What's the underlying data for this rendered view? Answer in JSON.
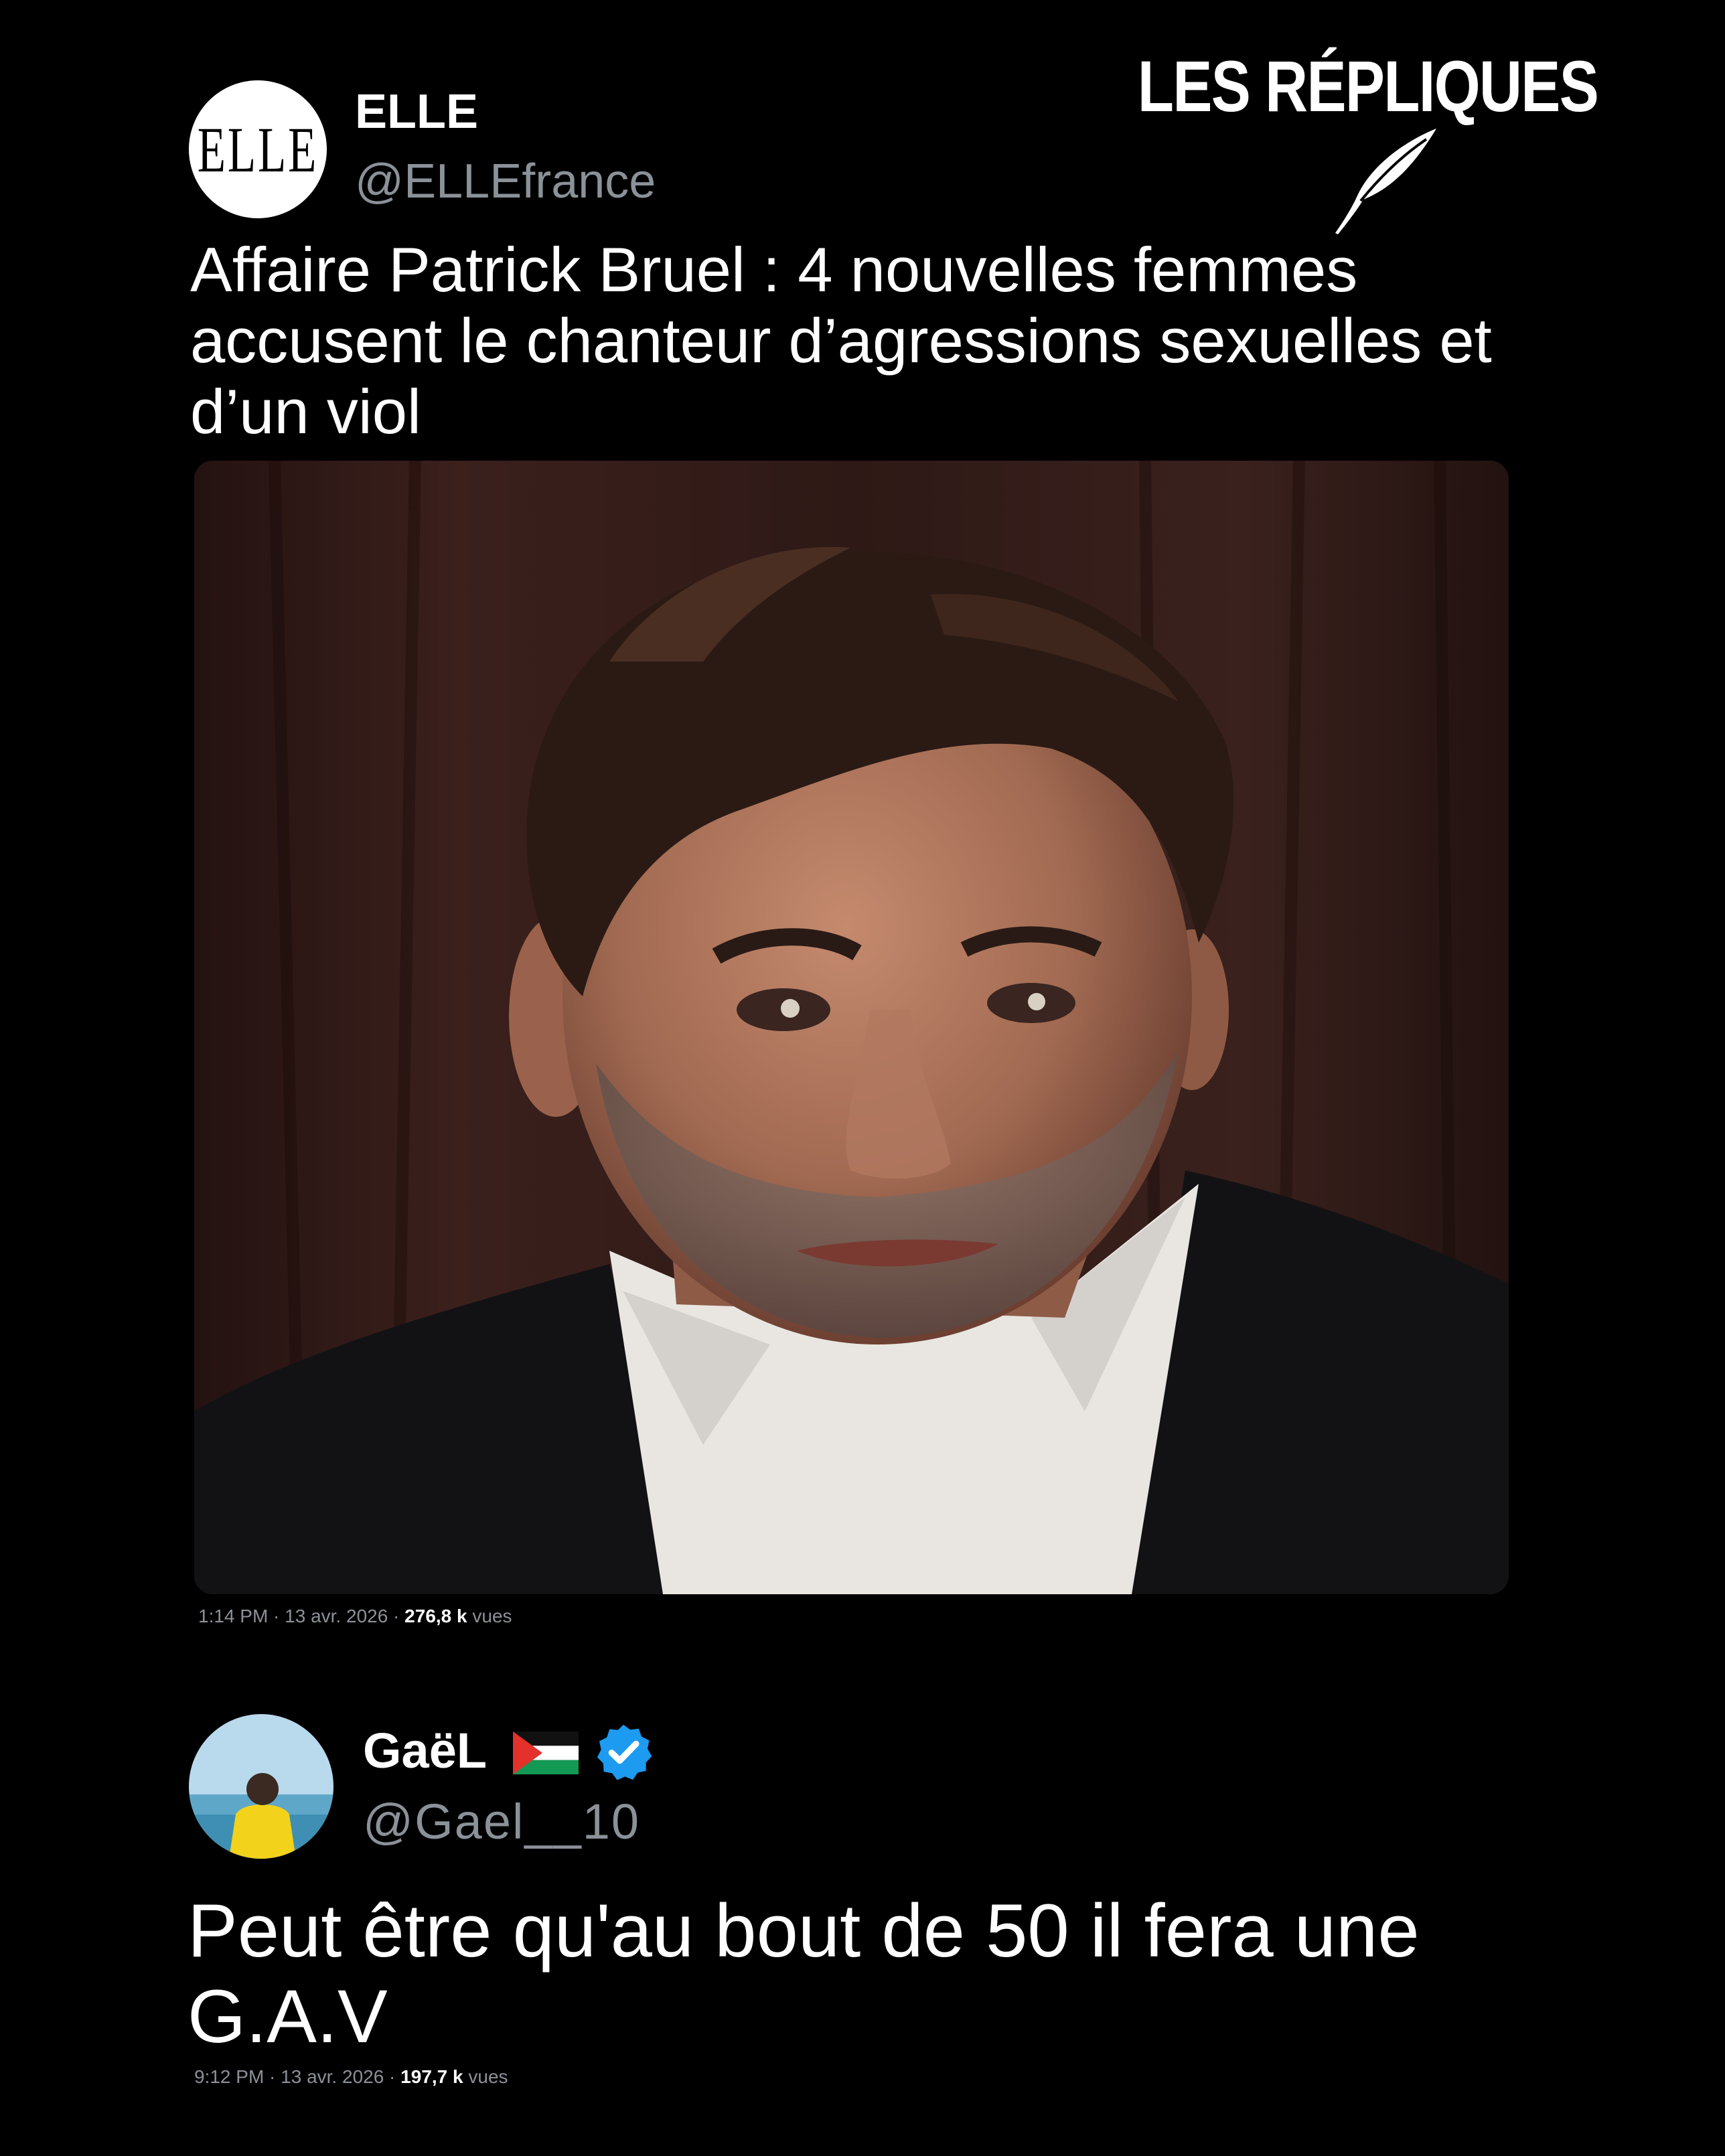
{
  "brand": {
    "title": "LES RÉPLIQUES",
    "icon": "quill-icon"
  },
  "tweet1": {
    "avatar_logo": "ELLE",
    "name": "ELLE",
    "handle": "@ELLEfrance",
    "text": "Affaire Patrick Bruel : 4 nouvelles femmes accusent le chanteur d’agressions sexuelles et d’un viol",
    "time": "1:14 PM · 13 avr. 2026 · ",
    "views": "276,8 k",
    "views_label": " vues"
  },
  "tweet2": {
    "name": "GaëL",
    "flag_icon": "palestine-flag-icon",
    "badge_icon": "verified-badge-icon",
    "handle": "@Gael__10",
    "text": "Peut être qu'au bout de 50 il fera une G.A.V",
    "time": "9:12 PM · 13 avr. 2026 · ",
    "views": "197,7 k",
    "views_label": " vues"
  },
  "colors": {
    "background": "#000000",
    "text": "#ffffff",
    "muted": "#8b9198",
    "verified": "#1d9bf0"
  }
}
